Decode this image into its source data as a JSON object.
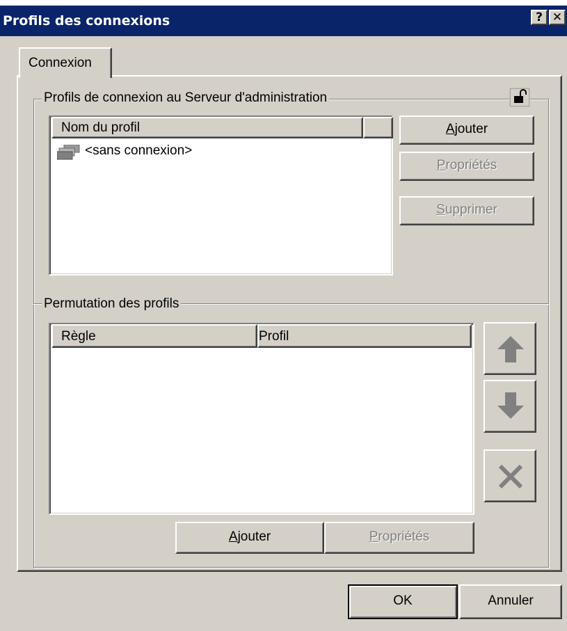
{
  "window": {
    "title": "Profils des connexions",
    "help_label": "?",
    "close_label": "✕"
  },
  "tabs": [
    {
      "label": "Connexion",
      "active": true
    }
  ],
  "lock_icon": "padlock-icon",
  "profiles_group": {
    "label": "Profils de connexion au Serveur d'administration",
    "list": {
      "column_header": "Nom du profil",
      "items": [
        {
          "icon": "servers-icon",
          "label": "<sans connexion>"
        }
      ]
    },
    "buttons": {
      "add": {
        "label": "Ajouter",
        "mnemonic": "A",
        "rest": "jouter",
        "enabled": true
      },
      "properties": {
        "label": "Propriétés",
        "mnemonic": "P",
        "rest": "ropriétés",
        "enabled": false
      },
      "delete": {
        "label": "Supprimer",
        "mnemonic": "S",
        "rest": "upprimer",
        "enabled": false
      }
    }
  },
  "switch_group": {
    "label": "Permutation des profils",
    "table": {
      "columns": [
        "Règle",
        "Profil"
      ],
      "rows": []
    },
    "side_buttons": [
      {
        "icon": "arrow-up-icon",
        "enabled": false
      },
      {
        "icon": "arrow-down-icon",
        "enabled": false
      },
      {
        "icon": "delete-x-icon",
        "enabled": false
      }
    ],
    "buttons": {
      "add": {
        "label": "Ajouter",
        "mnemonic": "A",
        "rest": "jouter",
        "enabled": true
      },
      "properties": {
        "label": "Propriétés",
        "mnemonic": "P",
        "rest": "ropriétés",
        "enabled": false
      }
    }
  },
  "footer": {
    "ok_label": "OK",
    "cancel_label": "Annuler"
  }
}
